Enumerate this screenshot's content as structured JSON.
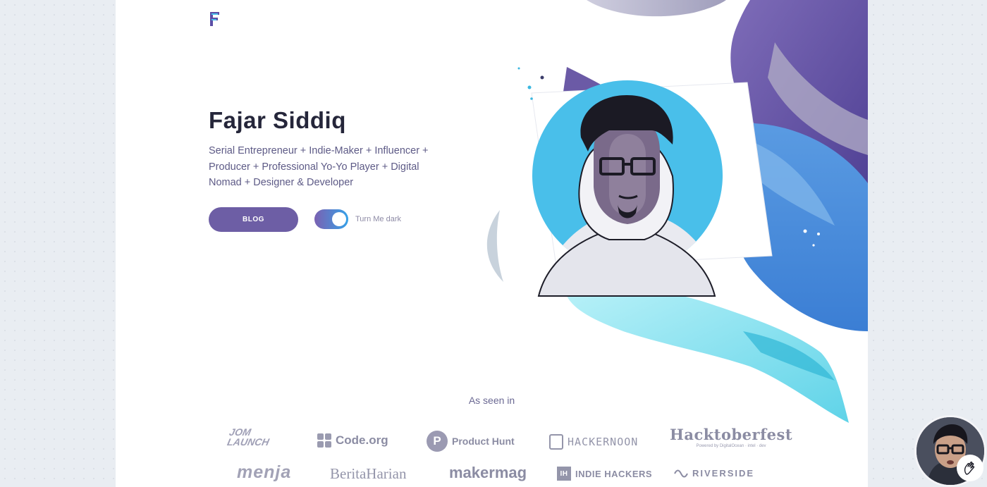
{
  "header": {
    "logo_icon": "fs-logo-icon"
  },
  "hero": {
    "name": "Fajar Siddiq",
    "tagline": "Serial Entrepreneur + Indie-Maker + Influencer + Producer + Professional Yo-Yo Player + Digital Nomad + Designer & Developer",
    "blog_button": "BLOG",
    "toggle_label": "Turn Me dark",
    "toggle_on": true,
    "portrait_icon": "avatar-illustration"
  },
  "press": {
    "heading": "As seen in",
    "logos": [
      {
        "line1": "JOM",
        "line2": "LAUNCH"
      },
      {
        "text": "Code.org"
      },
      {
        "text": "Product Hunt",
        "badge": "P"
      },
      {
        "text": "HACKERNOON"
      },
      {
        "text": "Hacktoberfest",
        "sub": "Powered by DigitalOcean · intel · dev"
      },
      {
        "text": "menja"
      },
      {
        "text": "BeritaHarian"
      },
      {
        "text": "makermag"
      },
      {
        "text": "INDIE HACKERS",
        "badge": "IH"
      },
      {
        "text": "RIVERSIDE"
      }
    ]
  },
  "colors": {
    "accent": "#6d5ea5",
    "title": "#25263a",
    "body": "#5d5a86",
    "sky_blue": "#4cc0ec",
    "purple_deep": "#5e4ea0"
  },
  "widget": {
    "avatar_icon": "video-avatar-icon",
    "badge_icon": "hand-wave-icon"
  }
}
